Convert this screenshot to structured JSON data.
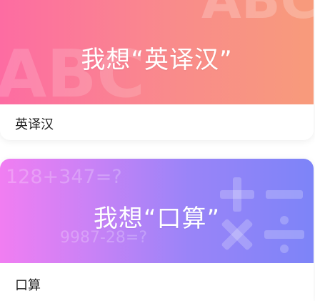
{
  "cards": [
    {
      "headline": "我想“英译汉”",
      "label": "英译汉",
      "decor_text_top": "ABC",
      "decor_text_left": "ABC"
    },
    {
      "headline": "我想“口算”",
      "label": "口算",
      "decor_equation_1": "128+347=?",
      "decor_equation_2": "9987-28=?",
      "decor_icons": [
        "plus-icon",
        "minus-icon",
        "multiply-icon",
        "divide-icon"
      ]
    }
  ],
  "colors": {
    "card1_gradient": [
      "#fd6ca2",
      "#f89b7b"
    ],
    "card2_gradient": [
      "#f17ef2",
      "#7d84f8"
    ],
    "label_text": "#222222"
  }
}
